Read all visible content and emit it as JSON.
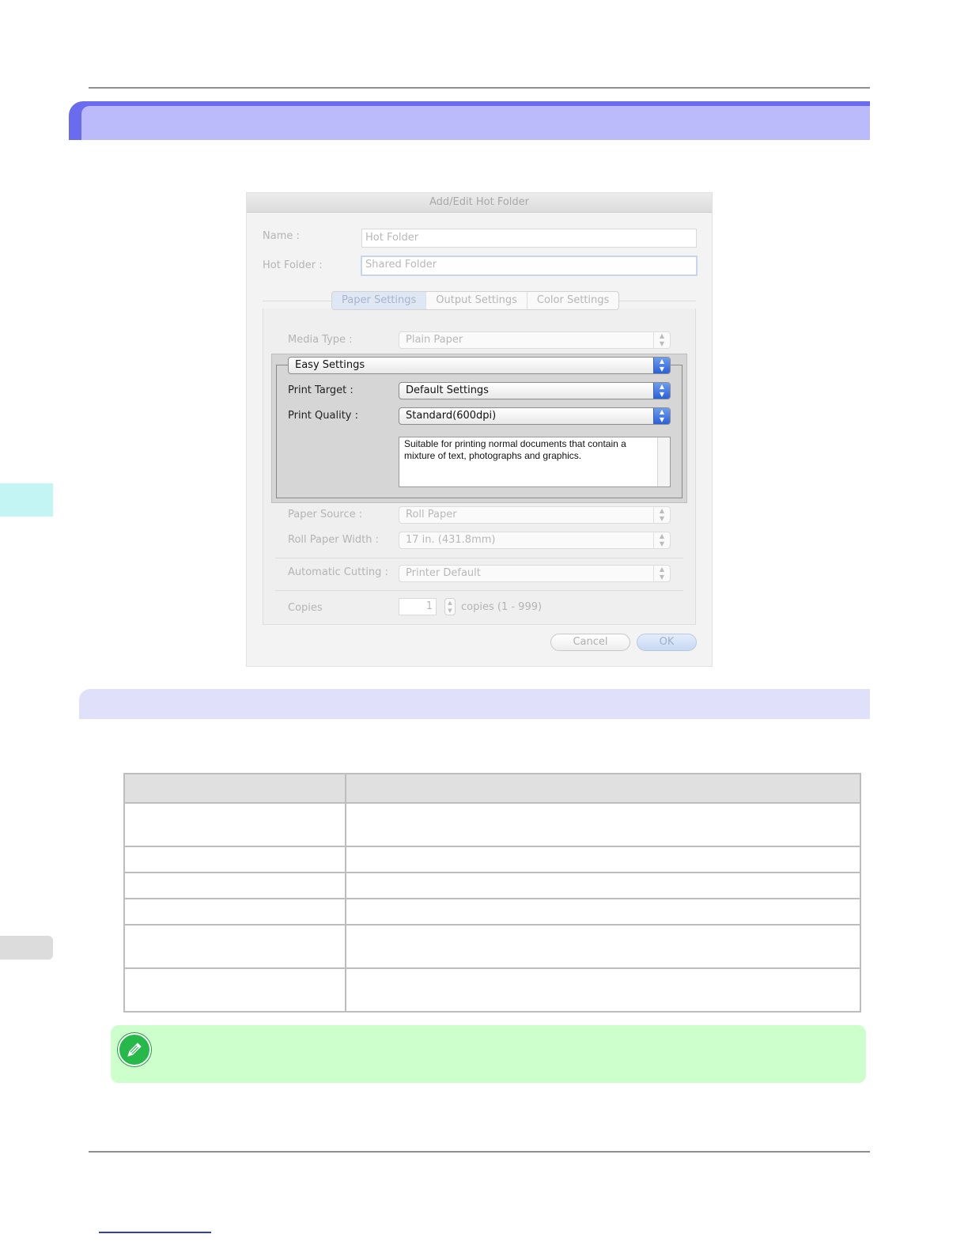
{
  "dialog": {
    "title": "Add/Edit Hot Folder",
    "name_label": "Name :",
    "name_value": "Hot Folder",
    "hot_folder_label": "Hot Folder :",
    "hot_folder_value": "Shared Folder",
    "tabs": [
      {
        "label": "Paper Settings",
        "active": true
      },
      {
        "label": "Output Settings",
        "active": false
      },
      {
        "label": "Color Settings",
        "active": false
      }
    ],
    "media_type_label": "Media Type :",
    "media_type_value": "Plain Paper",
    "easy_settings_value": "Easy Settings",
    "print_target_label": "Print Target :",
    "print_target_value": "Default Settings",
    "print_quality_label": "Print Quality :",
    "print_quality_value": "Standard(600dpi)",
    "description": "Suitable for printing normal documents that contain a mixture of text, photographs and graphics.",
    "paper_source_label": "Paper Source :",
    "paper_source_value": "Roll Paper",
    "roll_width_label": "Roll Paper Width :",
    "roll_width_value": "17 in. (431.8mm)",
    "auto_cut_label": "Automatic Cutting :",
    "auto_cut_value": "Printer Default",
    "copies_label": "Copies",
    "copies_value": "1",
    "copies_range": "copies (1 - 999)",
    "cancel_label": "Cancel",
    "ok_label": "OK"
  },
  "table": {
    "header": [
      "",
      ""
    ],
    "rows": [
      [
        "",
        ""
      ],
      [
        "",
        ""
      ],
      [
        "",
        ""
      ],
      [
        "",
        ""
      ],
      [
        "",
        ""
      ],
      [
        "",
        ""
      ]
    ]
  },
  "colors": {
    "section_bar": "#6b6bef",
    "section_bar_inner": "#bbbbfb",
    "sub_bar": "#e0e0fb",
    "note_bg": "#ccffcc",
    "side_tab_active": "#c4f5f5"
  },
  "icons": {
    "note": "pencil-note-icon"
  }
}
